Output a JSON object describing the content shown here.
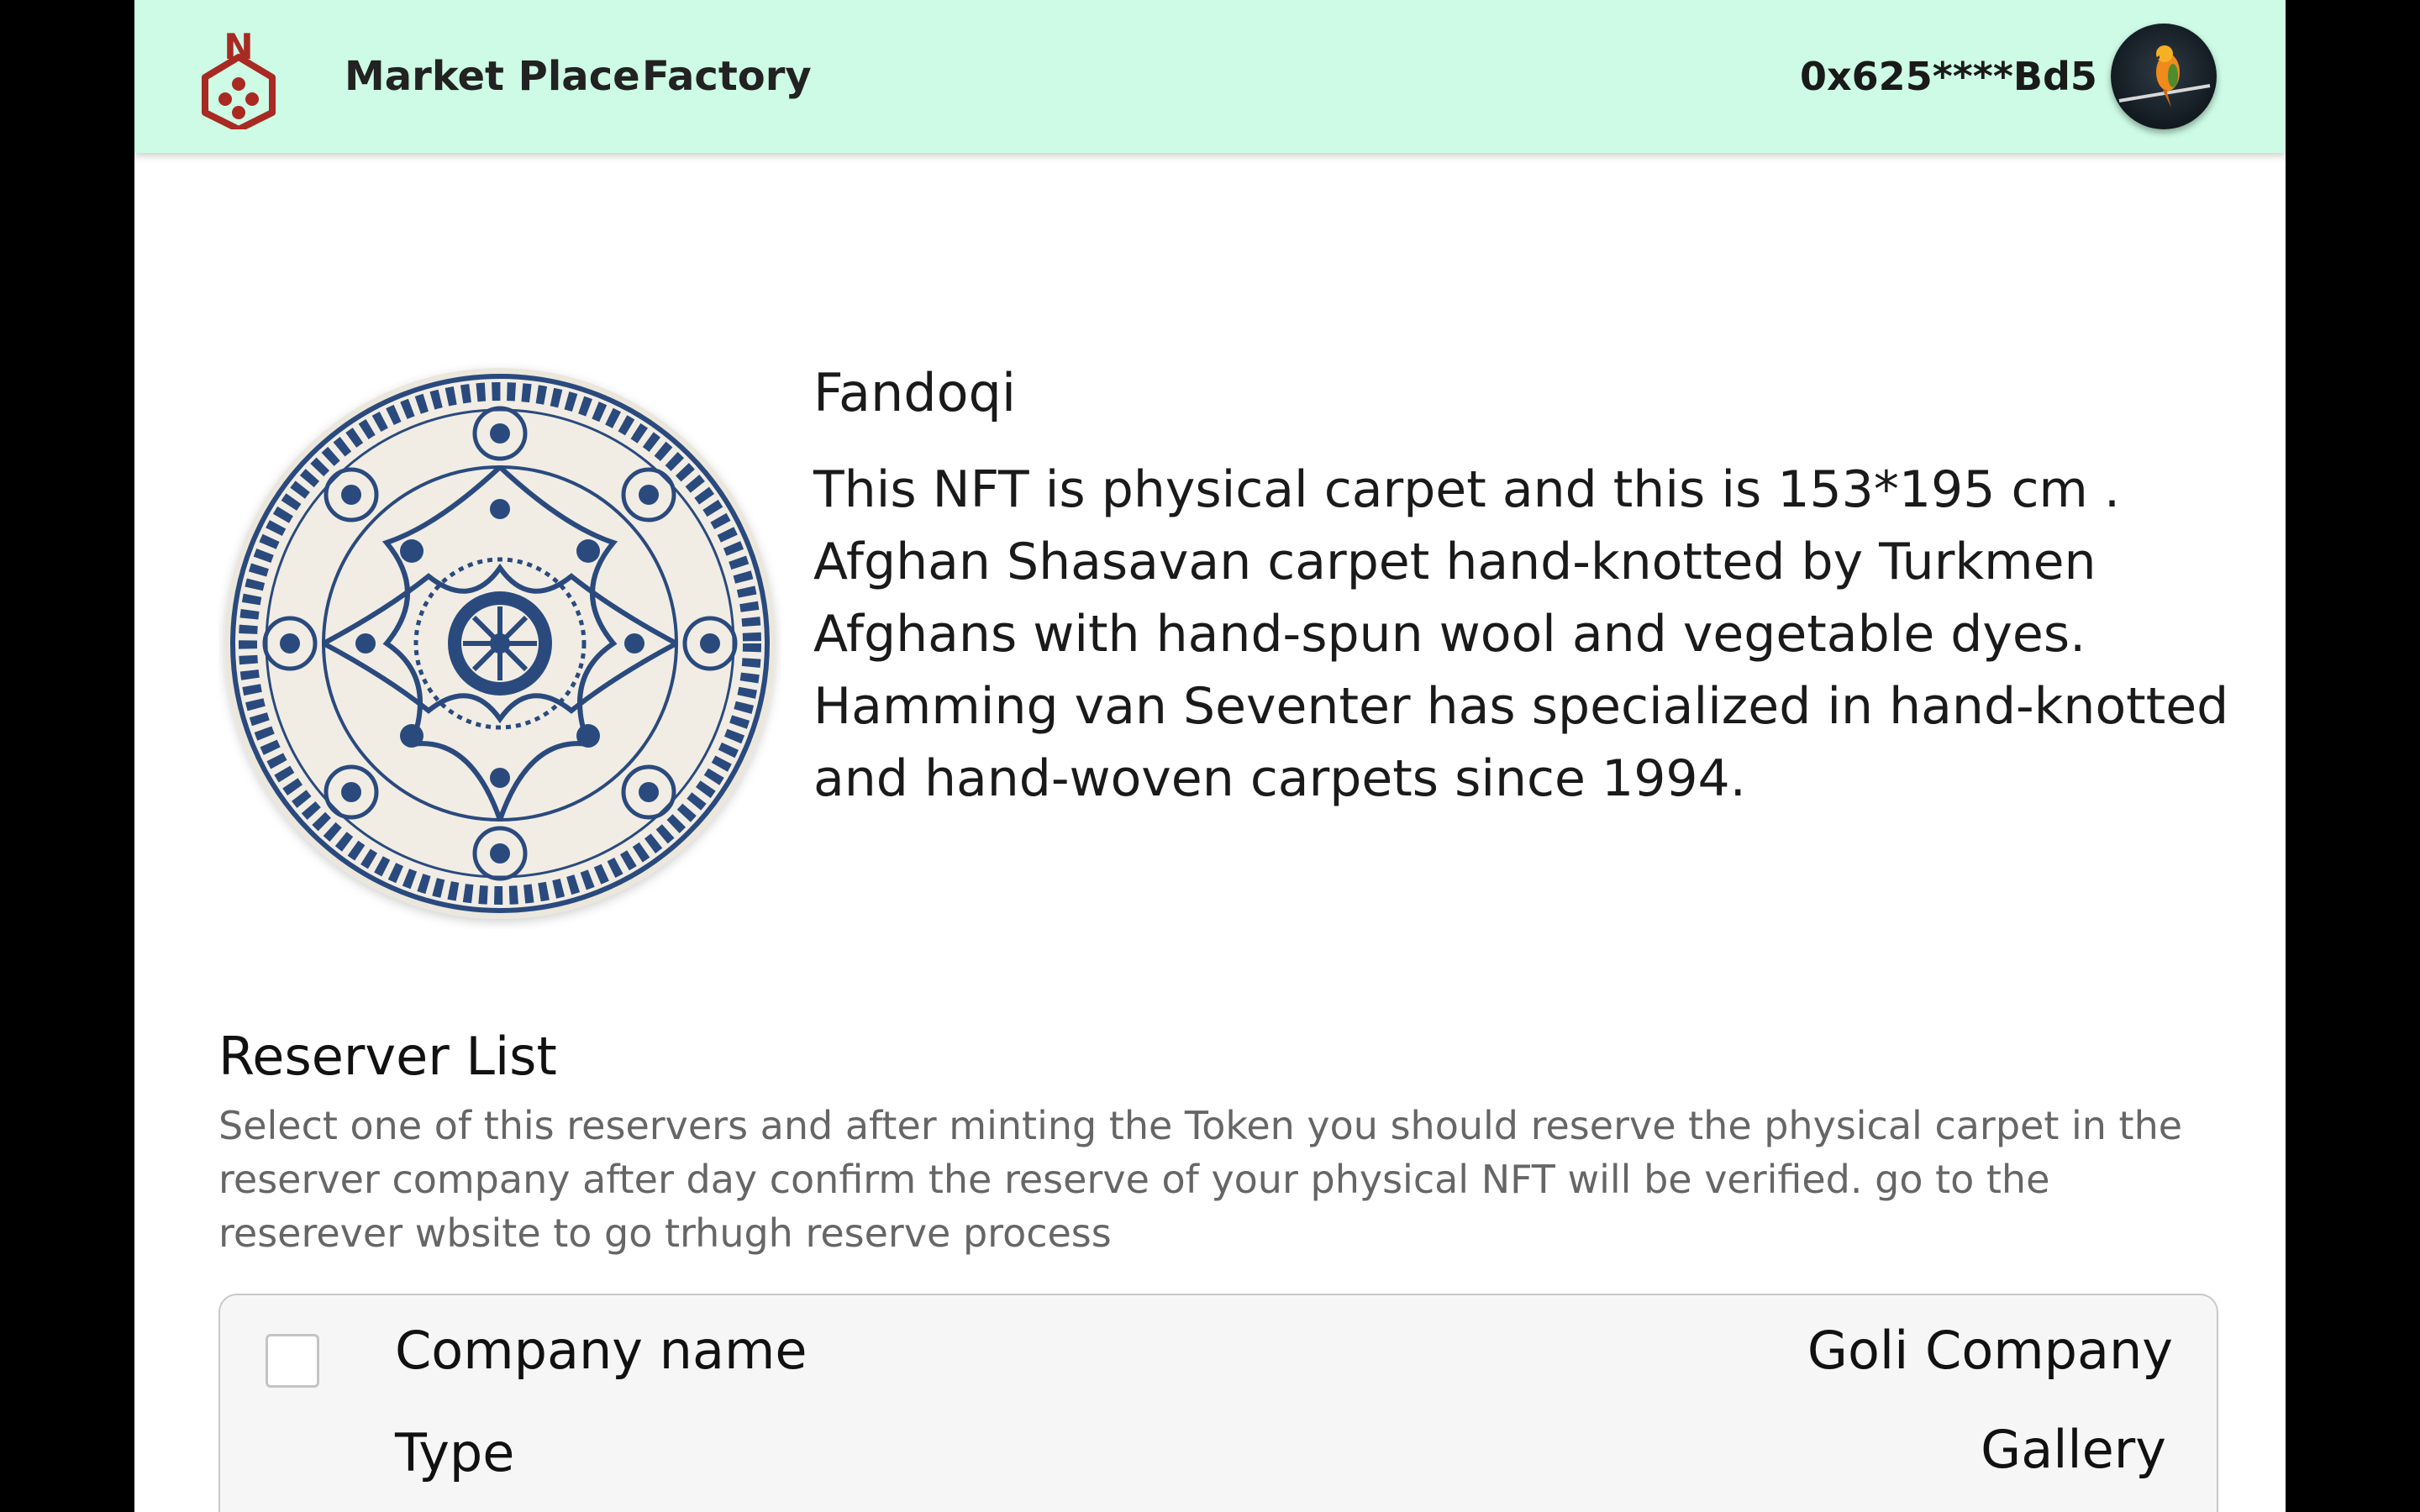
{
  "header": {
    "nav": [
      {
        "label": "Market Place"
      },
      {
        "label": "Factory"
      }
    ],
    "wallet_address": "0x625****Bd5",
    "logo_letter": "N",
    "colors": {
      "header_bg": "#cdfbe5",
      "logo": "#a82a22"
    }
  },
  "nft": {
    "title": "Fandoqi",
    "description": "This NFT is physical carpet and this is  153*195 cm . Afghan Shasavan carpet hand-knotted by Turkmen Afghans with hand-spun wool and vegetable dyes. Hamming van Seventer has specialized in hand-knotted and hand-woven carpets since 1994."
  },
  "reserver": {
    "title": "Reserver List",
    "description": "Select one of this reservers and after minting the Token you should reserve the physical carpet in the reserver company after day confirm the reserve of your physical NFT will be verified. go to the reserever wbsite to go trhugh reserve process",
    "items": [
      {
        "fields": [
          {
            "label": "Company name",
            "value": "Goli Company"
          },
          {
            "label": "Type",
            "value": "Gallery"
          }
        ]
      }
    ]
  }
}
